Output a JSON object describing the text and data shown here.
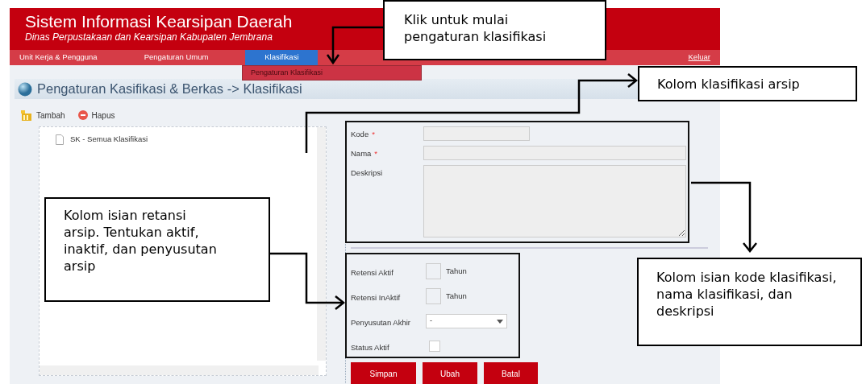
{
  "header": {
    "title": "Sistem Informasi Kearsipan Daerah",
    "subtitle": "Dinas Perpustakaan dan Kearsipan Kabupaten Jembrana"
  },
  "nav": {
    "items": [
      {
        "label": "Unit Kerja & Pengguna",
        "selected": false
      },
      {
        "label": "Pengaturan Umum",
        "selected": false
      },
      {
        "label": "Klasifikasi",
        "selected": true
      }
    ],
    "logout": "Keluar"
  },
  "dropdown": {
    "items": [
      "Pengaturan Klasifikasi"
    ]
  },
  "panel": {
    "title": "Pengaturan Kasifikasi & Berkas -> Klasifikasi"
  },
  "toolbar": [
    {
      "kind": "add",
      "label": "Tambah"
    },
    {
      "kind": "delete",
      "label": "Hapus"
    }
  ],
  "tree": {
    "items": [
      {
        "label": "SK - Semua Klasifikasi"
      }
    ]
  },
  "form": {
    "fields": [
      {
        "label": "Kode",
        "required_mark": "*",
        "kind": "short"
      },
      {
        "label": "Nama",
        "required_mark": "*",
        "kind": "long"
      },
      {
        "label": "Deskripsi",
        "kind": "textarea"
      }
    ]
  },
  "retention": {
    "fields": [
      {
        "label": "Retensi Aktif",
        "kind": "number",
        "unit": "Tahun"
      },
      {
        "label": "Retensi InAktif",
        "kind": "number",
        "unit": "Tahun"
      },
      {
        "label": "Penyusutan Akhir",
        "kind": "select",
        "value": "-"
      },
      {
        "label": "Status Aktif",
        "kind": "checkbox",
        "checked": false
      }
    ]
  },
  "buttons": [
    "Simpan",
    "Ubah",
    "Batal"
  ],
  "callouts": [
    {
      "text": "Klik untuk mulai pengaturan klasifikasi"
    },
    {
      "text": "Kolom klasifikasi arsip"
    },
    {
      "text": "Kolom isian retansi arsip. Tentukan aktif, inaktif, dan penyusutan arsip"
    },
    {
      "text": "Kolom isian kode klasifikasi, nama klasifikasi, dan deskripsi"
    }
  ]
}
